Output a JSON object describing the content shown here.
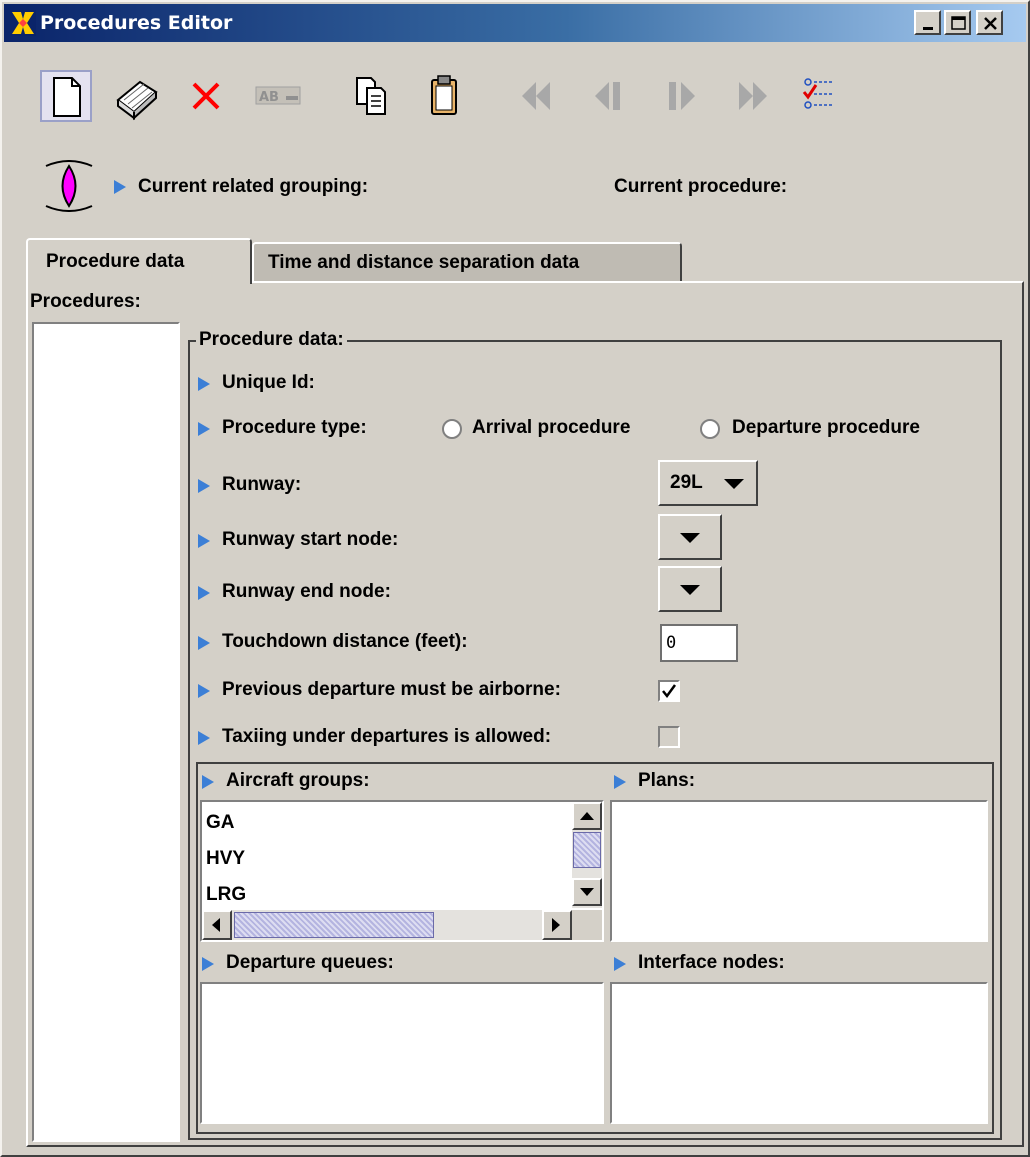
{
  "window": {
    "title": "Procedures Editor"
  },
  "toolbar": {
    "buttons": [
      {
        "name": "new",
        "icon": "new-document-icon"
      },
      {
        "name": "erase",
        "icon": "eraser-icon"
      },
      {
        "name": "delete",
        "icon": "delete-x-icon"
      },
      {
        "name": "rename",
        "icon": "rename-icon",
        "text": "AB"
      },
      {
        "name": "copy",
        "icon": "copy-icon"
      },
      {
        "name": "paste",
        "icon": "paste-icon"
      },
      {
        "name": "first",
        "icon": "first-record-icon"
      },
      {
        "name": "previous",
        "icon": "previous-record-icon"
      },
      {
        "name": "next",
        "icon": "next-record-icon"
      },
      {
        "name": "last",
        "icon": "last-record-icon"
      },
      {
        "name": "validate",
        "icon": "checklist-icon"
      }
    ]
  },
  "context": {
    "current_grouping_label": "Current related grouping:",
    "current_procedure_label": "Current procedure:"
  },
  "tabs": [
    {
      "label": "Procedure data",
      "active": true
    },
    {
      "label": "Time and distance separation data",
      "active": false
    }
  ],
  "procedures": {
    "label": "Procedures:",
    "items": []
  },
  "procedure_data": {
    "title": "Procedure data:",
    "unique_id_label": "Unique Id:",
    "procedure_type_label": "Procedure type:",
    "arrival_option": "Arrival procedure",
    "departure_option": "Departure procedure",
    "runway_label": "Runway:",
    "runway_value": "29L",
    "runway_start_label": "Runway start node:",
    "runway_end_label": "Runway end node:",
    "touchdown_label": "Touchdown distance (feet):",
    "touchdown_value": "0",
    "prev_departure_label": "Previous departure must be airborne:",
    "prev_departure_checked": true,
    "taxiing_label": "Taxiing under departures is allowed:",
    "taxiing_checked": false
  },
  "lists": {
    "aircraft_groups_label": "Aircraft groups:",
    "aircraft_groups": [
      "GA",
      "HVY",
      "LRG"
    ],
    "plans_label": "Plans:",
    "departure_queues_label": "Departure queues:",
    "interface_nodes_label": "Interface nodes:"
  },
  "colors": {
    "title_gradient_start": "#0a246a",
    "title_gradient_end": "#a6caf0",
    "panel_bg": "#d4d0c8",
    "bullet_arrow": "#3c7fd6",
    "delete_red": "#ff0000",
    "grouping_magenta": "#ff00ff"
  }
}
